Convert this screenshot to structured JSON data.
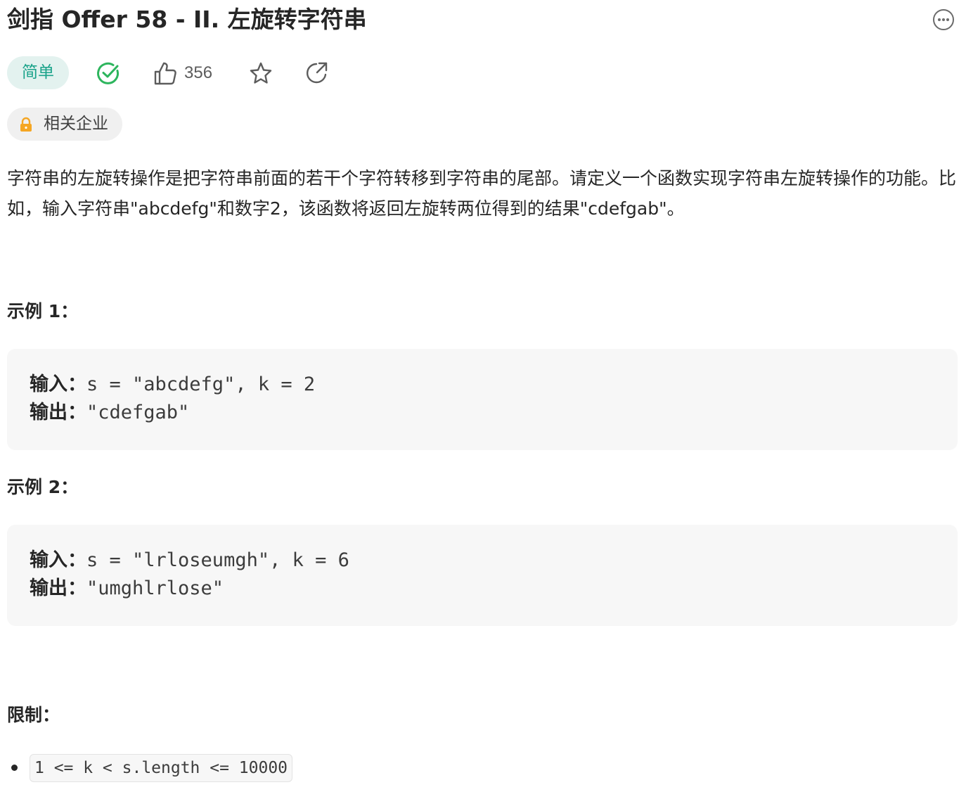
{
  "problem": {
    "title": "剑指 Offer 58 - II. 左旋转字符串",
    "difficulty": "简单",
    "likes": "356",
    "company_tag": "相关企业",
    "description": "字符串的左旋转操作是把字符串前面的若干个字符转移到字符串的尾部。请定义一个函数实现字符串左旋转操作的功能。比如，输入字符串\"abcdefg\"和数字2，该函数将返回左旋转两位得到的结果\"cdefgab\"。"
  },
  "icons": {
    "more": "more-options-icon",
    "solved": "check-circle-icon",
    "like": "thumbs-up-icon",
    "favorite": "star-icon",
    "share": "share-icon",
    "lock": "lock-icon"
  },
  "colors": {
    "easy_green": "#1aa38a",
    "easy_bg": "#e3f2ef",
    "lock_orange": "#f5a623"
  },
  "examples": [
    {
      "heading": "示例 1：",
      "input_label": "输入：",
      "input_value": "s = \"abcdefg\", k = 2",
      "output_label": "输出：",
      "output_value": "\"cdefgab\""
    },
    {
      "heading": "示例 2：",
      "input_label": "输入：",
      "input_value": "s = \"lrloseumgh\", k = 6",
      "output_label": "输出：",
      "output_value": "\"umghlrlose\""
    }
  ],
  "limits": {
    "heading": "限制：",
    "items": [
      "1 <= k < s.length <= 10000"
    ]
  }
}
